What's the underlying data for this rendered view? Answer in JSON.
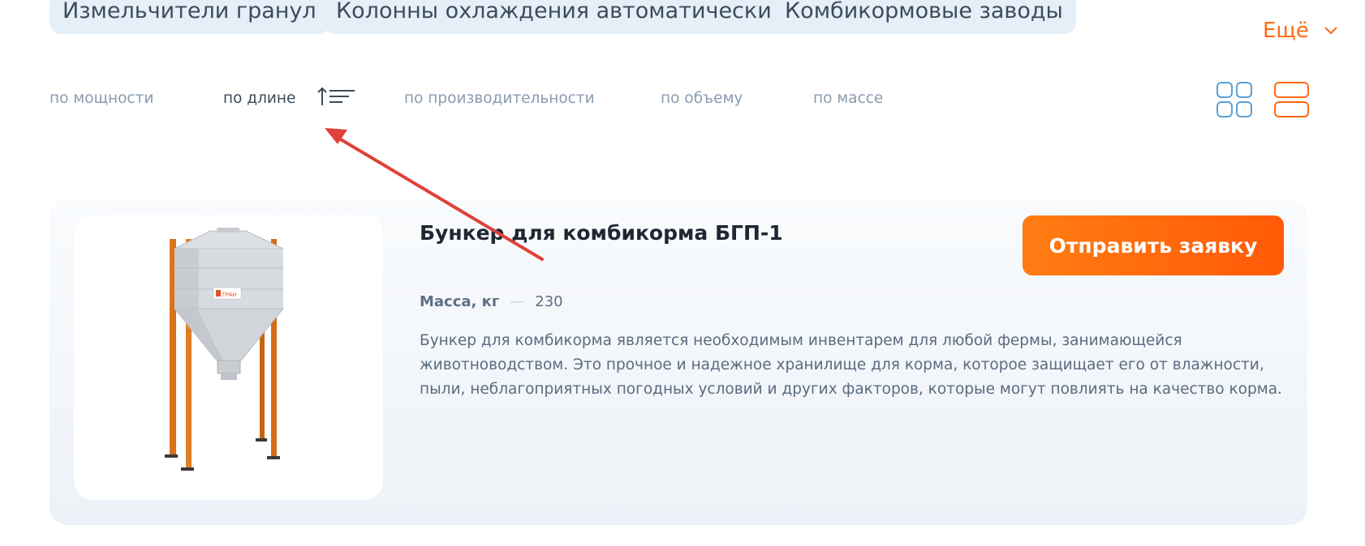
{
  "categories": {
    "items": [
      {
        "label": "Измельчители гранул"
      },
      {
        "label": "Колонны охлаждения автоматические"
      },
      {
        "label": "Комбикормовые заводы"
      }
    ],
    "more_label": "Ещё"
  },
  "sort": {
    "options": [
      {
        "label": "по мощности"
      },
      {
        "label": "по длине"
      },
      {
        "label": "по производительности"
      },
      {
        "label": "по объему"
      },
      {
        "label": "по массе"
      }
    ],
    "active": "по длине",
    "direction": "ascending"
  },
  "view": {
    "modes": [
      "grid-view-icon",
      "list-view-icon"
    ],
    "active_mode": "list"
  },
  "product": {
    "title": "Бункер для комбикорма БГП-1",
    "cta_label": "Отправить заявку",
    "specs": [
      {
        "label": "Масса, кг",
        "value": "230"
      }
    ],
    "description": "Бункер для комбикорма является необходимым инвентарем для любой фермы, занимающейся животноводством. Это прочное и надежное хранилище для корма, которое защищает его от влажности, пыли, неблагоприятных погодных условий и других факторов, которые могут повлиять на качество корма.",
    "image_brand": "ГРАН"
  },
  "colors": {
    "accent": "#ff6a13",
    "chip_bg": "#e5eff8",
    "grid_icon": "#5aa0d6",
    "annotation_arrow": "#e0403a"
  }
}
